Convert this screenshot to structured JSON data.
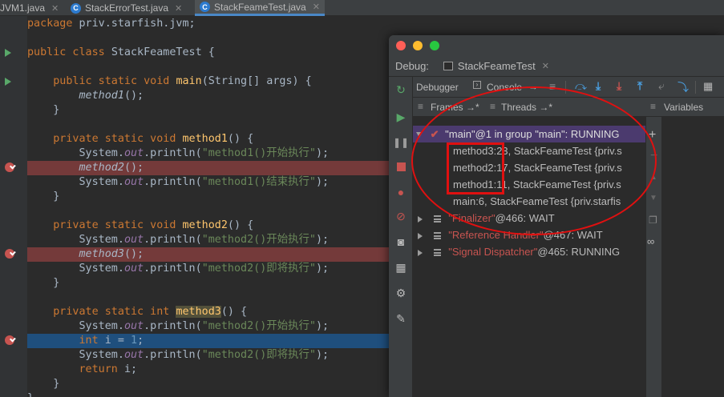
{
  "editor_tabs": [
    {
      "label": "JVM1.java",
      "active": false
    },
    {
      "label": "StackErrorTest.java",
      "active": false
    },
    {
      "label": "StackFeameTest.java",
      "active": true
    }
  ],
  "code": {
    "l0": {
      "a": "package ",
      "b": "priv.starfish.jvm;"
    },
    "l2": {
      "a": "public class ",
      "b": "StackFeameTest {"
    },
    "l4": {
      "a": "    public static void ",
      "b": "main",
      "c": "(String[] args) {"
    },
    "l5": {
      "a": "        ",
      "b": "method1",
      "c": "();"
    },
    "l6": "    }",
    "l8": {
      "a": "    private static void ",
      "b": "method1",
      "c": "() {"
    },
    "l9": {
      "a": "        System.",
      "b": "out",
      "c": ".println(",
      "d": "\"method1()开始执行\"",
      "e": ");"
    },
    "l10": {
      "a": "        ",
      "b": "method2",
      "c": "();"
    },
    "l11": {
      "a": "        System.",
      "b": "out",
      "c": ".println(",
      "d": "\"method1()结束执行\"",
      "e": ");"
    },
    "l12": "    }",
    "l14": {
      "a": "    private static void ",
      "b": "method2",
      "c": "() {"
    },
    "l15": {
      "a": "        System.",
      "b": "out",
      "c": ".println(",
      "d": "\"method2()开始执行\"",
      "e": ");"
    },
    "l16": {
      "a": "        ",
      "b": "method3",
      "c": "();"
    },
    "l17": {
      "a": "        System.",
      "b": "out",
      "c": ".println(",
      "d": "\"method2()即将执行\"",
      "e": ");"
    },
    "l18": "    }",
    "l20": {
      "a": "    private static int ",
      "b": "method3",
      "c": "() {"
    },
    "l21": {
      "a": "        System.",
      "b": "out",
      "c": ".println(",
      "d": "\"method2()开始执行\"",
      "e": ");"
    },
    "l22": {
      "a": "        int ",
      "b": "i = ",
      "c": "1",
      "d": ";"
    },
    "l23": {
      "a": "        System.",
      "b": "out",
      "c": ".println(",
      "d": "\"method2()即将执行\"",
      "e": ");"
    },
    "l24": {
      "a": "        return ",
      "b": "i;"
    },
    "l25": "    }",
    "l26": "}"
  },
  "debug": {
    "label": "Debug:",
    "session_tab": "StackFeameTest",
    "toolbar": {
      "debugger": "Debugger",
      "console": "Console",
      "console_arrow": "→"
    },
    "frames_label": "Frames →*",
    "threads_label": "Threads →*",
    "variables_label": "Variables",
    "rows": [
      {
        "main": "\"main\"@1 in group \"main\": RUNNING"
      },
      {
        "a": "method3",
        "b": ":23, StackFeameTest {priv.s"
      },
      {
        "a": "method2",
        "b": ":17, StackFeameTest {priv.s"
      },
      {
        "a": "method1",
        "b": ":11, StackFeameTest {priv.s"
      },
      {
        "a": "main",
        "b": ":6, StackFeameTest {priv.starfis"
      },
      {
        "q": "\"Finalizer\"",
        "r": "@466: WAIT"
      },
      {
        "q": "\"Reference Handler\"",
        "r": "@467: WAIT"
      },
      {
        "q": "\"Signal Dispatcher\"",
        "r": "@465: RUNNING"
      }
    ]
  },
  "colors": {
    "annotation": "#e01010",
    "keyword": "#cc7832",
    "method": "#ffc66d",
    "string": "#6a8759"
  }
}
